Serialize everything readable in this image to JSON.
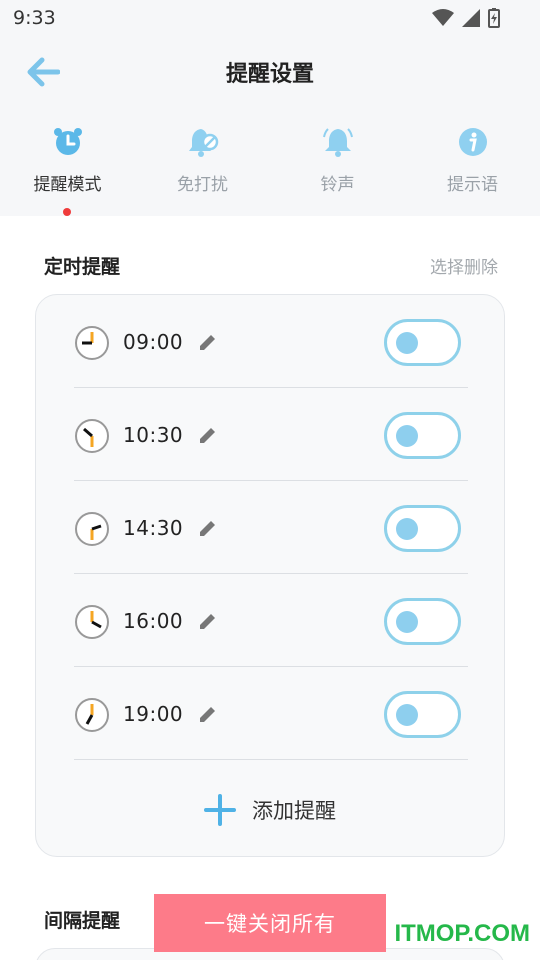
{
  "status_bar": {
    "time": "9:33"
  },
  "header": {
    "title": "提醒设置"
  },
  "tabs": [
    {
      "label": "提醒模式",
      "icon": "alarm-clock-icon",
      "active": true
    },
    {
      "label": "免打扰",
      "icon": "bell-off-icon",
      "active": false
    },
    {
      "label": "铃声",
      "icon": "bell-icon",
      "active": false
    },
    {
      "label": "提示语",
      "icon": "info-icon",
      "active": false
    }
  ],
  "timed_section": {
    "title": "定时提醒",
    "action": "选择删除",
    "reminders": [
      {
        "time": "09:00",
        "enabled": false
      },
      {
        "time": "10:30",
        "enabled": false
      },
      {
        "time": "14:30",
        "enabled": false
      },
      {
        "time": "16:00",
        "enabled": false
      },
      {
        "time": "19:00",
        "enabled": false
      }
    ],
    "add_label": "添加提醒"
  },
  "interval_section": {
    "title": "间隔提醒"
  },
  "close_all_label": "一键关闭所有",
  "watermark": "ITMOP.COM",
  "colors": {
    "accent": "#5bb8e8",
    "toggle_border": "#8ed1ea",
    "close_button": "#fd7b89",
    "dot": "#ef3b3b",
    "clock_hand": "#f5a623"
  }
}
